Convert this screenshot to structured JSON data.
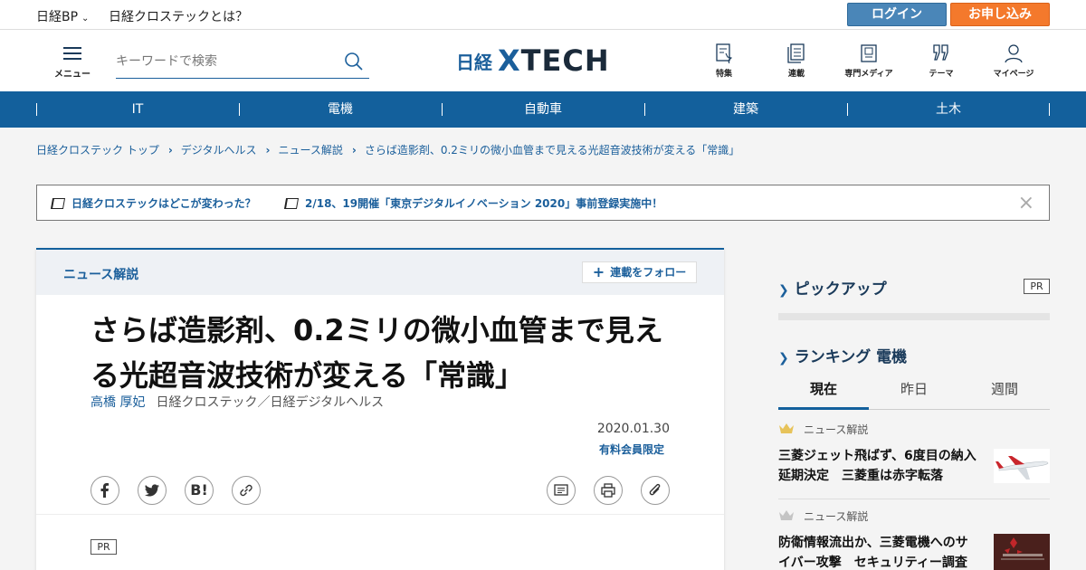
{
  "util": {
    "nikkei_bp": "日経BP",
    "about": "日経クロステックとは？",
    "login": "ログイン",
    "apply": "お申し込み"
  },
  "header": {
    "menu_label": "メニュー",
    "search_placeholder": "キーワードで検索",
    "logo_nikkei": "日経",
    "logo_x": "X",
    "logo_tech": "TECH",
    "nav": [
      {
        "label": "特集",
        "icon": "feature-icon"
      },
      {
        "label": "連載",
        "icon": "series-icon"
      },
      {
        "label": "専門メディア",
        "icon": "media-icon"
      },
      {
        "label": "テーマ",
        "icon": "theme-icon"
      },
      {
        "label": "マイページ",
        "icon": "user-icon"
      }
    ]
  },
  "categories": [
    "IT",
    "電機",
    "自動車",
    "建築",
    "土木"
  ],
  "breadcrumb": [
    "日経クロステック トップ",
    "デジタルヘルス",
    "ニュース解説",
    "さらば造影剤、0.2ミリの微小血管まで見える光超音波技術が変える「常識」"
  ],
  "notice": {
    "item1": "日経クロステックはどこが変わった？",
    "item2": "2/18、19開催「東京デジタルイノベーション 2020」事前登録実施中！",
    "close": "×"
  },
  "article": {
    "category": "ニュース解説",
    "follow": "連載をフォロー",
    "title": "さらば造影剤、0.2ミリの微小血管まで見える光超音波技術が変える「常識」",
    "author": "高橋 厚妃",
    "publication": "日経クロステック／日経デジタルヘルス",
    "date": "2020.01.30",
    "paid": "有料会員限定",
    "pr": "PR"
  },
  "sidebar": {
    "pickup": "ピックアップ",
    "pr": "PR",
    "ranking": "ランキング 電機",
    "tabs": [
      "現在",
      "昨日",
      "週間"
    ],
    "items": [
      {
        "category": "ニュース解説",
        "title": "三菱ジェット飛ばず、6度目の納入延期決定　三菱重は赤字転落"
      },
      {
        "category": "ニュース解説",
        "title": "防衛情報流出か、三菱電機へのサイバー攻撃　セキュリティー調査"
      }
    ]
  },
  "colors": {
    "brand": "#13609c",
    "login": "#4a86b8",
    "apply": "#f4792c"
  }
}
